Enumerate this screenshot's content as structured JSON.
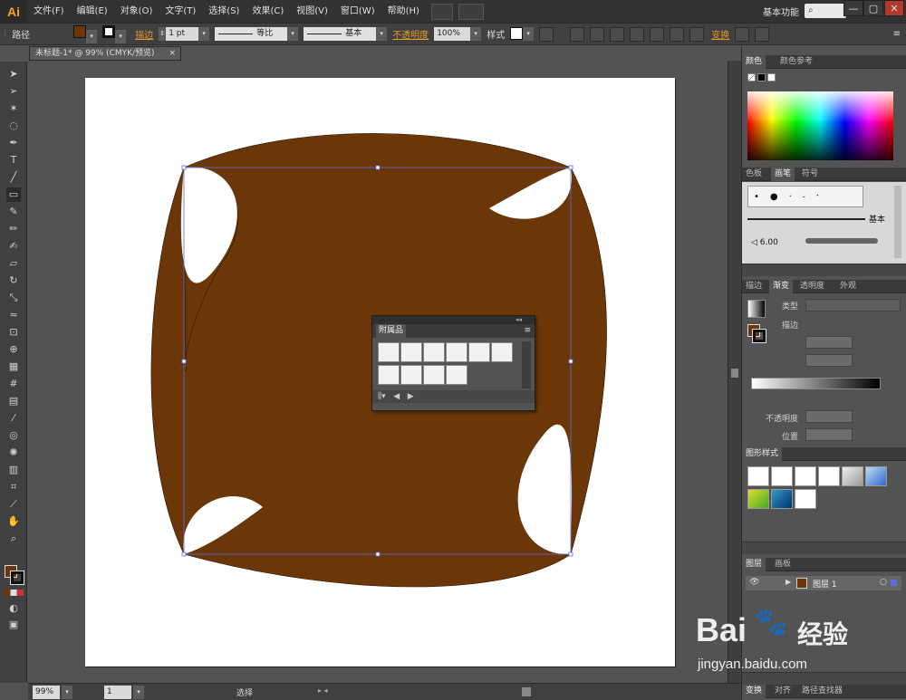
{
  "app": {
    "logo": "Ai"
  },
  "menu": [
    "文件(F)",
    "编辑(E)",
    "对象(O)",
    "文字(T)",
    "选择(S)",
    "效果(C)",
    "视图(V)",
    "窗口(W)",
    "帮助(H)"
  ],
  "workspace": "基本功能",
  "window_controls": [
    "—",
    "▢",
    "✕"
  ],
  "control_bar": {
    "selection_label": "路径",
    "stroke_label": "描边",
    "stroke_weight": "1 pt",
    "profile_label": "等比",
    "brush_label": "基本",
    "opacity_label": "不透明度",
    "opacity_value": "100%",
    "style_label": "样式",
    "transform_label": "变换"
  },
  "document_tab": {
    "title": "未标题-1* @ 99% (CMYK/预览)",
    "close": "×"
  },
  "status_bar": {
    "zoom": "99%",
    "artboard": "1",
    "tool": "选择"
  },
  "color_panel": {
    "tabs": [
      "颜色",
      "颜色参考"
    ]
  },
  "brush_panel": {
    "tabs": [
      "色板",
      "画笔",
      "符号"
    ],
    "basic_label": "基本",
    "size": "6.00"
  },
  "gradient_panel": {
    "tabs": [
      "描边",
      "渐变",
      "透明度",
      "外观"
    ],
    "type_label": "类型",
    "stroke_label": "描边",
    "opacity_label": "不透明度",
    "position_label": "位置"
  },
  "graphic_styles_panel": {
    "tabs": [
      "图形样式"
    ]
  },
  "layers_panel": {
    "tabs": [
      "图层",
      "画板"
    ],
    "layer_name": "图层 1"
  },
  "bottom_panel": {
    "tabs": [
      "变换",
      "对齐",
      "路径查找器"
    ]
  },
  "symbol_panel": {
    "title": "附属品"
  },
  "watermark": {
    "brand": "Bai",
    "brand_cn": "经验",
    "url": "jingyan.baidu.com"
  },
  "colors": {
    "shape_fill": "#6b3708",
    "selection": "#5b6fd8",
    "accent_orange": "#e39a2b"
  }
}
